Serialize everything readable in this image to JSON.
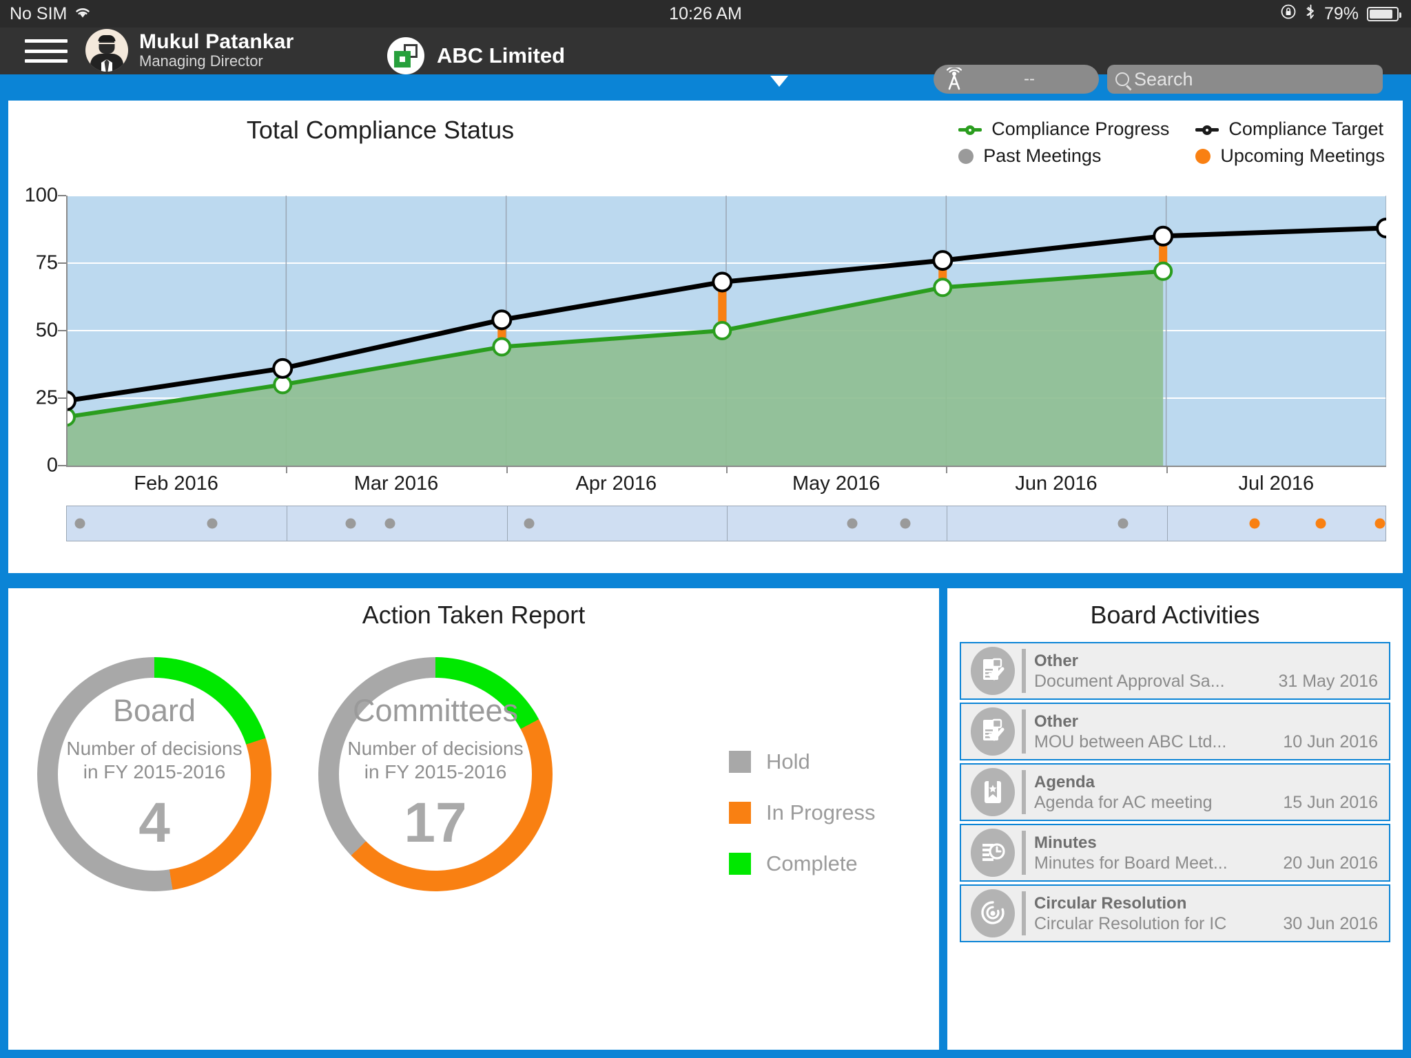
{
  "status_bar": {
    "carrier": "No SIM",
    "wifi_icon": "wifi-icon",
    "time": "10:26 AM",
    "orientation_lock_icon": "rotation-lock-icon",
    "bluetooth_icon": "bluetooth-icon",
    "battery_percent": "79%",
    "battery_level": 79
  },
  "nav": {
    "menu_icon": "hamburger-menu-icon",
    "avatar_icon": "user-avatar-icon",
    "user_name": "Mukul  Patankar",
    "user_role": "Managing Director",
    "company_logo_icon": "company-logo-icon",
    "company_name": "ABC Limited",
    "company_dropdown_icon": "chevron-down-icon",
    "signal_icon": "cell-tower-icon",
    "signal_value": "--",
    "search_icon": "search-icon",
    "search_value": "",
    "search_placeholder": "Search"
  },
  "compliance": {
    "title": "Total Compliance Status"
  },
  "action_report": {
    "title": "Action Taken Report",
    "legend": [
      {
        "label": "Hold",
        "color": "#a8a8a8"
      },
      {
        "label": "In Progress",
        "color": "#f98012"
      },
      {
        "label": "Complete",
        "color": "#00e800"
      }
    ],
    "donuts": [
      {
        "name": "Board",
        "subtitle_line1": "Number of decisions",
        "subtitle_line2": "in FY 2015-2016",
        "value": "4"
      },
      {
        "name": "Committees",
        "subtitle_line1": "Number of decisions",
        "subtitle_line2": "in FY 2015-2016",
        "value": "17"
      }
    ]
  },
  "activities": {
    "title": "Board Activities",
    "items": [
      {
        "icon": "document-approval-icon",
        "type": "Other",
        "description": "Document Approval Sa...",
        "date": "31 May 2016"
      },
      {
        "icon": "document-approval-icon",
        "type": "Other",
        "description": "MOU between ABC Ltd...",
        "date": "10 Jun 2016"
      },
      {
        "icon": "agenda-bookmark-icon",
        "type": "Agenda",
        "description": "Agenda for AC meeting",
        "date": "15 Jun 2016"
      },
      {
        "icon": "minutes-clock-icon",
        "type": "Minutes",
        "description": "Minutes for Board Meet...",
        "date": "20 Jun 2016"
      },
      {
        "icon": "circular-resolution-icon",
        "type": "Circular Resolution",
        "description": "Circular Resolution for IC",
        "date": "30 Jun 2016"
      }
    ]
  },
  "chart_data": {
    "type": "line",
    "title": "Total Compliance Status",
    "xlabel": "",
    "ylabel": "",
    "ylim": [
      0,
      100
    ],
    "yticks": [
      0,
      25,
      50,
      75,
      100
    ],
    "grid": true,
    "legend_position": "top-right",
    "categories": [
      "Feb 2016",
      "Mar 2016",
      "Apr 2016",
      "May 2016",
      "Jun 2016",
      "Jul 2016"
    ],
    "x": [
      0,
      20,
      40,
      60,
      80,
      100
    ],
    "series": [
      {
        "name": "Compliance Target",
        "color": "#000000",
        "marker": "white-circle",
        "x": [
          0,
          16.4,
          33.0,
          49.7,
          66.4,
          83.1,
          100
        ],
        "values": [
          24,
          36,
          54,
          68,
          76,
          85,
          88
        ]
      },
      {
        "name": "Compliance Progress",
        "color": "#2a9d1e",
        "marker": "white-circle",
        "fill": "#8fbf92",
        "x": [
          0,
          16.4,
          33.0,
          49.7,
          66.4,
          83.1
        ],
        "values": [
          18,
          30,
          44,
          50,
          66,
          72
        ]
      }
    ],
    "gap_bars": {
      "name": "Target vs Progress gap",
      "color": "#f98012",
      "x": [
        0,
        16.4,
        33.0,
        49.7,
        66.4,
        83.1
      ]
    },
    "meetings_timeline": {
      "past_color": "#9a9a9a",
      "upcoming_color": "#f98012",
      "past_meetings_x": [
        1.0,
        11.0,
        21.5,
        24.5,
        35.0,
        59.5,
        63.5,
        80.0
      ],
      "upcoming_meetings_x": [
        90.0,
        95.0,
        99.5
      ]
    }
  },
  "colors": {
    "accent_blue": "#0b84d6",
    "plot_background": "#bcd9ef",
    "progress_fill": "#8fbf92",
    "progress_green": "#2a9d1e",
    "target_black": "#000000",
    "orange": "#f98012",
    "grey": "#a8a8a8",
    "complete_green": "#00e800"
  }
}
